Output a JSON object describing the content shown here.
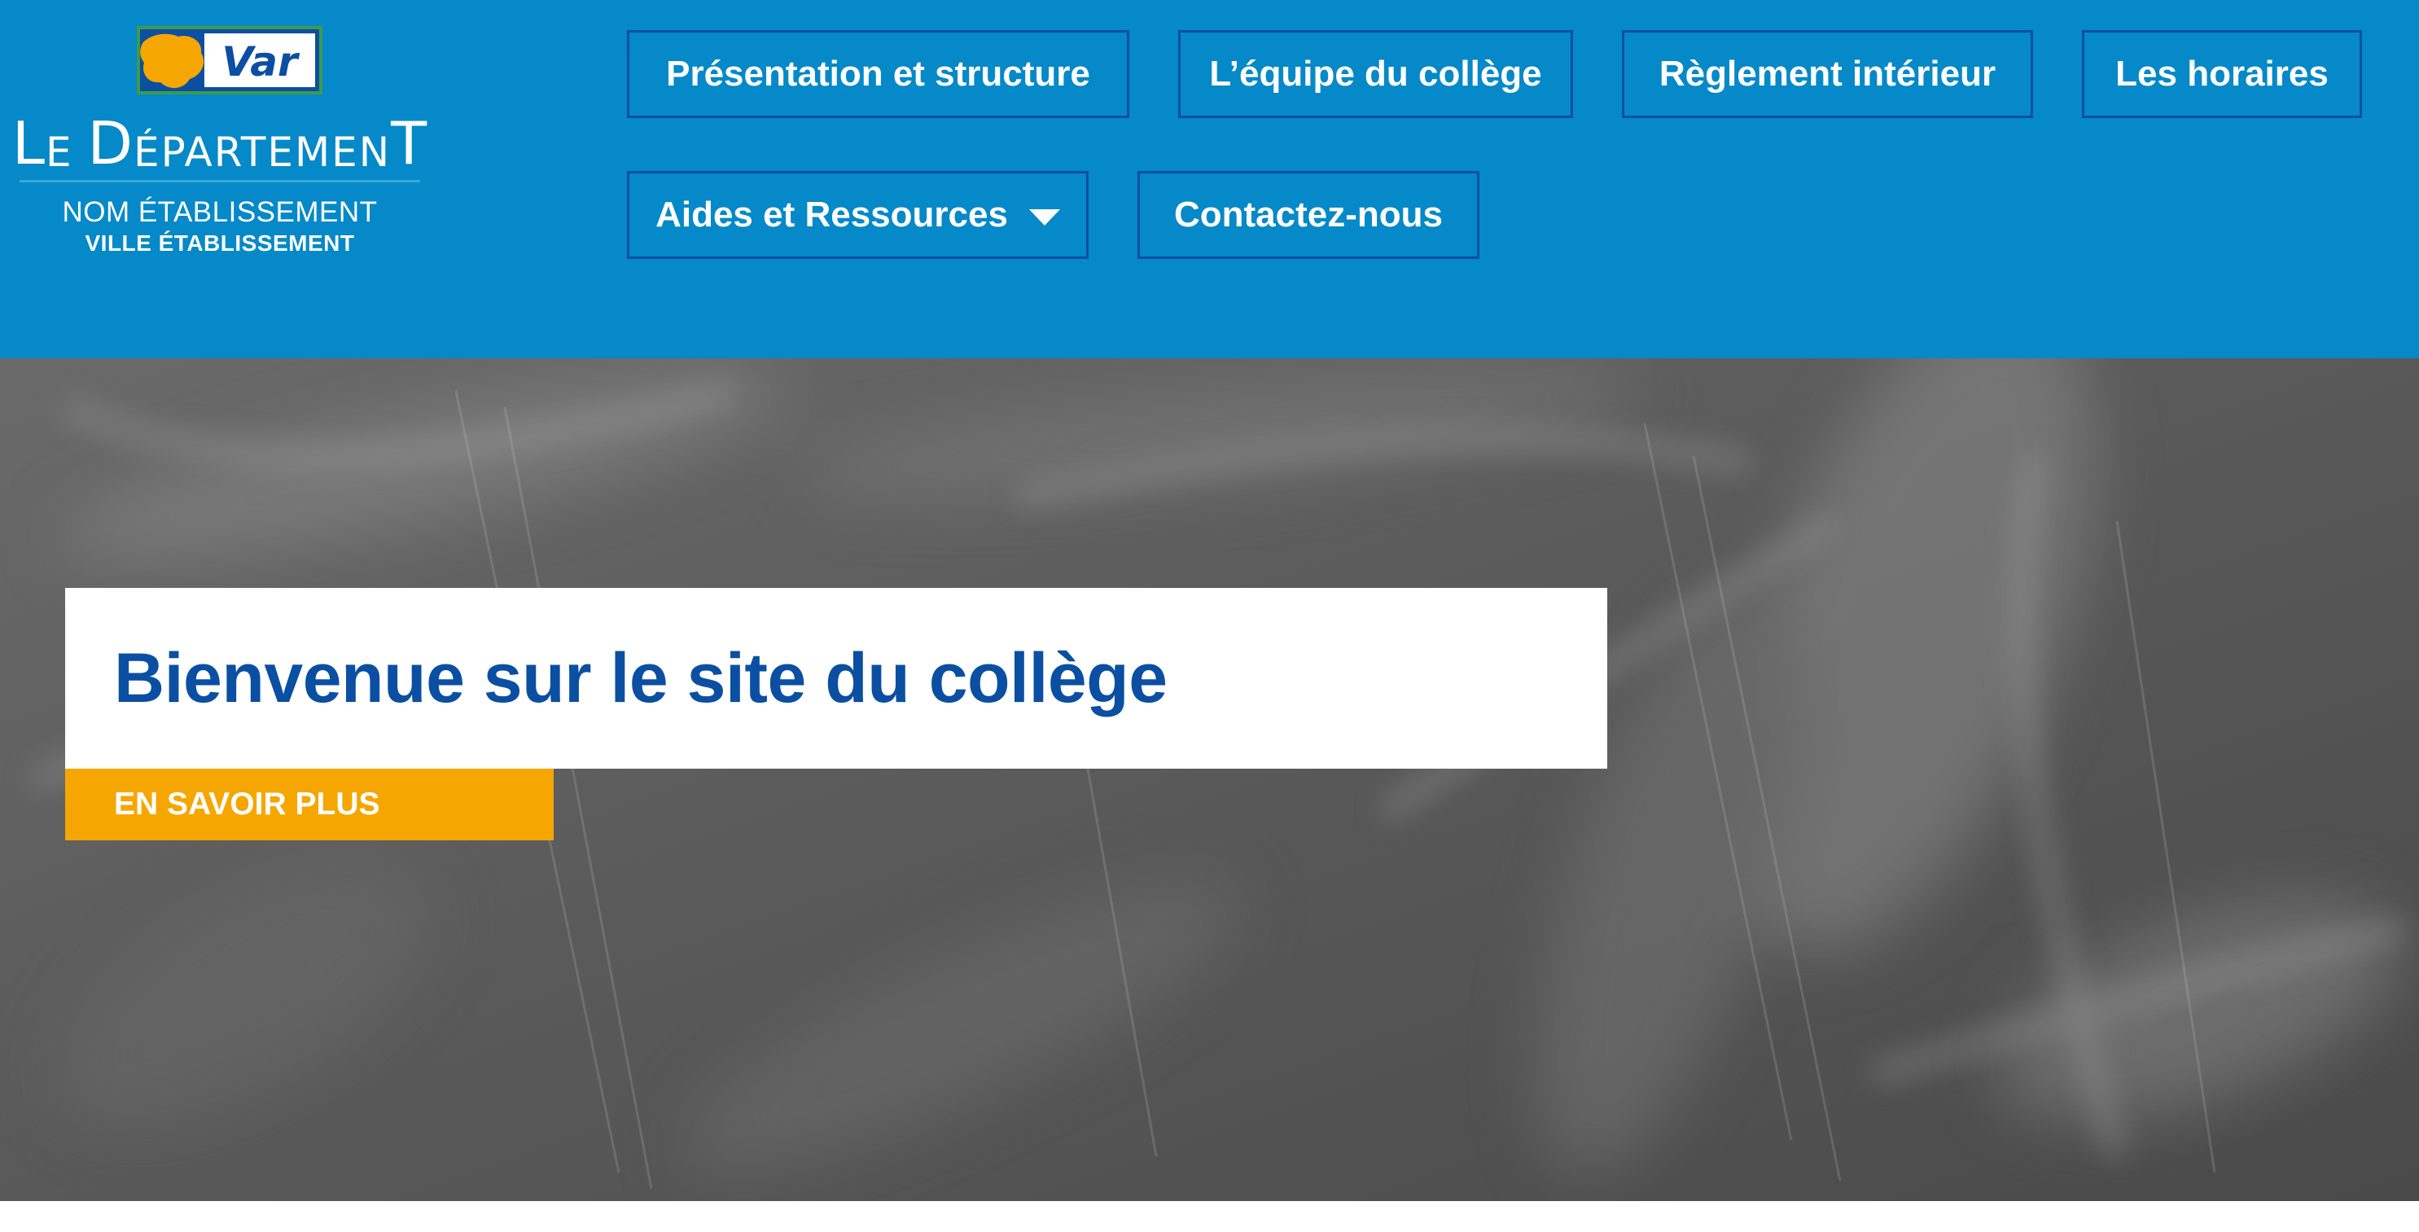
{
  "header": {
    "logo": {
      "name": "Var",
      "department_line": "Le Département",
      "colors": {
        "map": "#f6a600",
        "badge_bg": "#ffffff",
        "badge_text": "#0b4fa3",
        "map_outline": "#3f9a4a"
      }
    },
    "school_name": "NOM ÉTABLISSEMENT",
    "school_city": "VILLE ÉTABLISSEMENT",
    "nav": {
      "items": [
        {
          "label": "Présentation et structure"
        },
        {
          "label": "L’équipe du collège"
        },
        {
          "label": "Règlement intérieur"
        },
        {
          "label": "Les horaires"
        },
        {
          "label": "Aides et Ressources",
          "icon": "chevron-down-icon"
        },
        {
          "label": "Contactez-nous"
        }
      ]
    }
  },
  "hero": {
    "title": "Bienvenue sur le site du collège",
    "cta_label": "EN SAVOIR PLUS",
    "background": "chalkboard"
  },
  "colors": {
    "header_bg": "#0589c8",
    "nav_border": "#0b4fa3",
    "title_text": "#0b4fa3",
    "cta_bg": "#f6a600",
    "chalkboard": "#5a5a5a"
  }
}
